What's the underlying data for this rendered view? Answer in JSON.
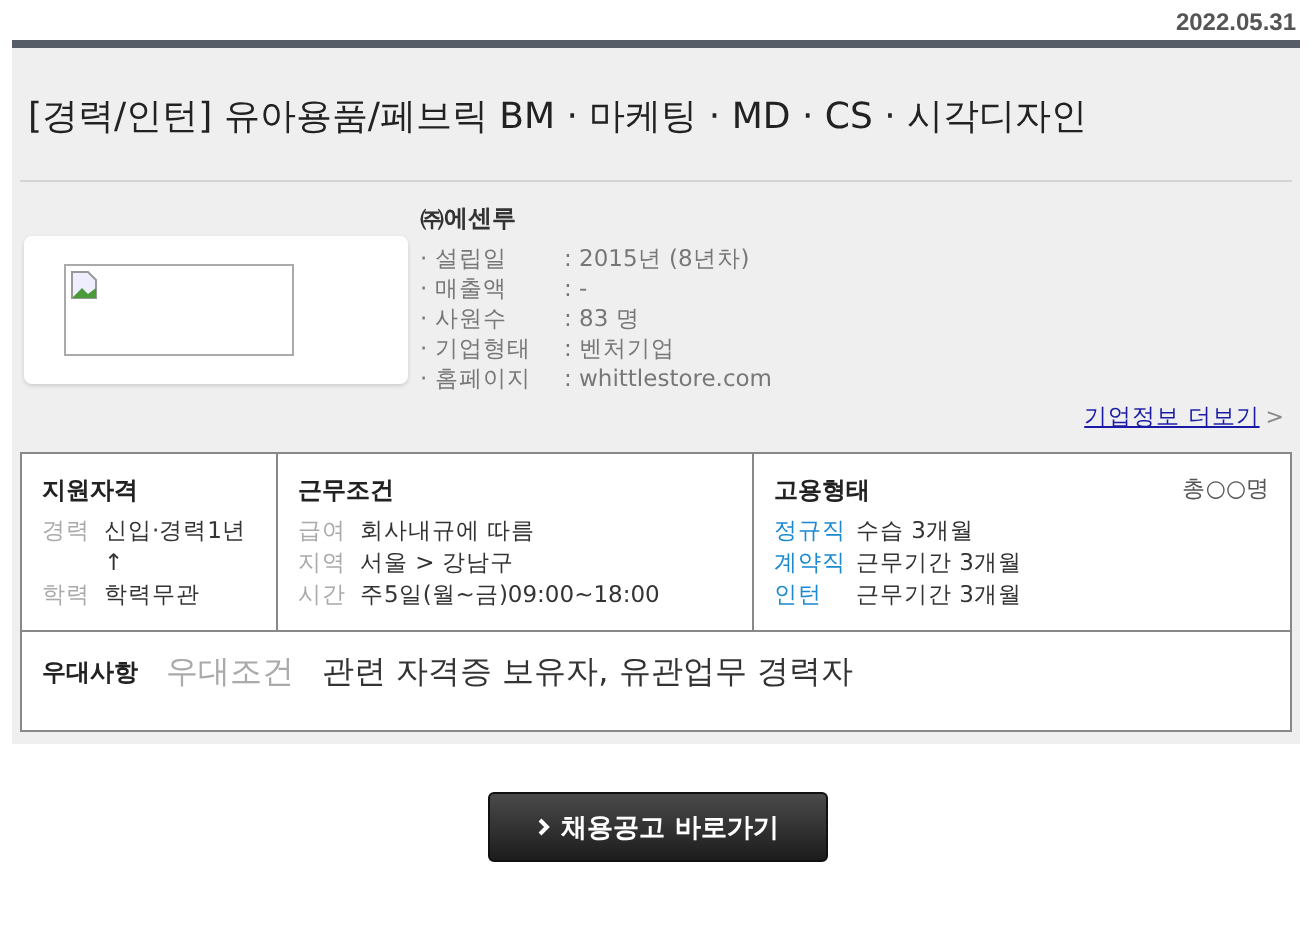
{
  "date": "2022.05.31",
  "title": "[경력/인턴] 유아용품/페브릭 BM · 마케팅 · MD · CS · 시각디자인",
  "company": {
    "name": "㈜에센루",
    "logo": {
      "kind": "broken-image"
    },
    "info": [
      {
        "label": "· 설립일",
        "value": ": 2015년 (8년차)"
      },
      {
        "label": "· 매출액",
        "value": ": -"
      },
      {
        "label": "· 사원수",
        "value": ": 83 명"
      },
      {
        "label": "· 기업형태",
        "value": ": 벤처기업"
      },
      {
        "label": "· 홈페이지",
        "value": ": whittlestore.com"
      }
    ],
    "more_link": "기업정보 더보기",
    "more_icon": ">"
  },
  "qualification": {
    "heading": "지원자격",
    "rows": [
      {
        "label": "경력",
        "value": "신입·경력1년\n↑"
      },
      {
        "label": "학력",
        "value": "학력무관"
      }
    ]
  },
  "conditions": {
    "heading": "근무조건",
    "rows": [
      {
        "label": "급여",
        "value": "회사내규에 따름"
      },
      {
        "label": "지역",
        "value": "서울 > 강남구"
      },
      {
        "label": "시간",
        "value": "주5일(월~금)09:00~18:00"
      }
    ]
  },
  "employment": {
    "heading": "고용형태",
    "total": "총○○명",
    "rows": [
      {
        "label": "정규직",
        "value": "수습 3개월"
      },
      {
        "label": "계약직",
        "value": "근무기간 3개월"
      },
      {
        "label": "인턴",
        "value": "근무기간 3개월"
      }
    ]
  },
  "preference": {
    "heading": "우대사항",
    "label": "우대조건",
    "value": "관련 자격증 보유자, 유관업무 경력자"
  },
  "apply_button": "채용공고 바로가기"
}
